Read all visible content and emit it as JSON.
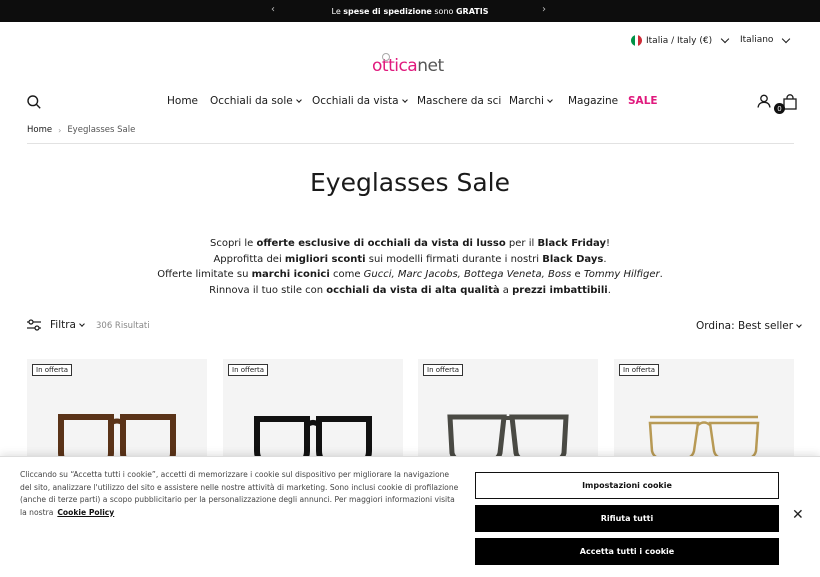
{
  "announcement": {
    "prefix": "Le ",
    "bold1": "spese di spedizione",
    "middle": " sono ",
    "bold2": "GRATIS",
    "prev_arrow": "‹",
    "next_arrow": "›"
  },
  "header": {
    "country": "Italia / Italy (€)",
    "language": "Italiano",
    "logo_part1": "ottica",
    "logo_part2": "net",
    "cart_count": "0"
  },
  "nav": {
    "items": [
      {
        "label": "Home",
        "dropdown": false
      },
      {
        "label": "Occhiali da sole",
        "dropdown": true
      },
      {
        "label": "Occhiali da vista",
        "dropdown": true
      },
      {
        "label": "Maschere da sci",
        "dropdown": false
      },
      {
        "label": "Marchi",
        "dropdown": true
      },
      {
        "label": "Magazine",
        "dropdown": false
      },
      {
        "label": "SALE",
        "dropdown": false
      }
    ]
  },
  "breadcrumb": {
    "home": "Home",
    "separator": "›",
    "current": "Eyeglasses Sale"
  },
  "page": {
    "title": "Eyeglasses Sale",
    "desc": {
      "l1_a": "Scopri le ",
      "l1_b": "offerte esclusive di occhiali da vista di lusso",
      "l1_c": " per il ",
      "l1_d": "Black Friday",
      "l1_e": "!",
      "l2_a": "Approfitta dei ",
      "l2_b": "migliori sconti",
      "l2_c": " sui modelli firmati durante i nostri ",
      "l2_d": "Black Days",
      "l2_e": ".",
      "l3_a": "Offerte limitate su ",
      "l3_b": "marchi iconici",
      "l3_c": " come ",
      "l3_d": "Gucci, Marc Jacobs, Bottega Veneta, Boss",
      "l3_e": " e ",
      "l3_f": "Tommy Hilfiger",
      "l3_g": ".",
      "l4_a": "Rinnova il tuo stile con ",
      "l4_b": "occhiali da vista di alta qualità",
      "l4_c": " a ",
      "l4_d": "prezzi imbattibili",
      "l4_e": "."
    }
  },
  "toolbar": {
    "filter_label": "Filtra",
    "results": "306 Risultati",
    "sort_label": "Ordina: Best seller"
  },
  "products": [
    {
      "badge": "In offerta",
      "frame_color": "#5a3318"
    },
    {
      "badge": "In offerta",
      "frame_color": "#111111"
    },
    {
      "badge": "In offerta",
      "frame_color": "#4a4a44"
    },
    {
      "badge": "In offerta",
      "frame_color": "#b89a55"
    }
  ],
  "cookie": {
    "text": "Cliccando su “Accetta tutti i cookie”, accetti di memorizzare i cookie sul dispositivo per migliorare la navigazione del sito, analizzare l'utilizzo del sito e assistere nelle nostre attività di marketing. Sono inclusi cookie di profilazione (anche di terze parti) a scopo pubblicitario per la personalizzazione degli annunci. Per maggiori informazioni visita la nostra",
    "policy_link": "Cookie Policy",
    "settings_button": "Impostazioni cookie",
    "reject_button": "Rifiuta tutti",
    "accept_button": "Accetta tutti i cookie",
    "close": "✕"
  },
  "colors": {
    "brand_pink": "#e0197d",
    "announcement_bg": "#0d0d0d"
  }
}
